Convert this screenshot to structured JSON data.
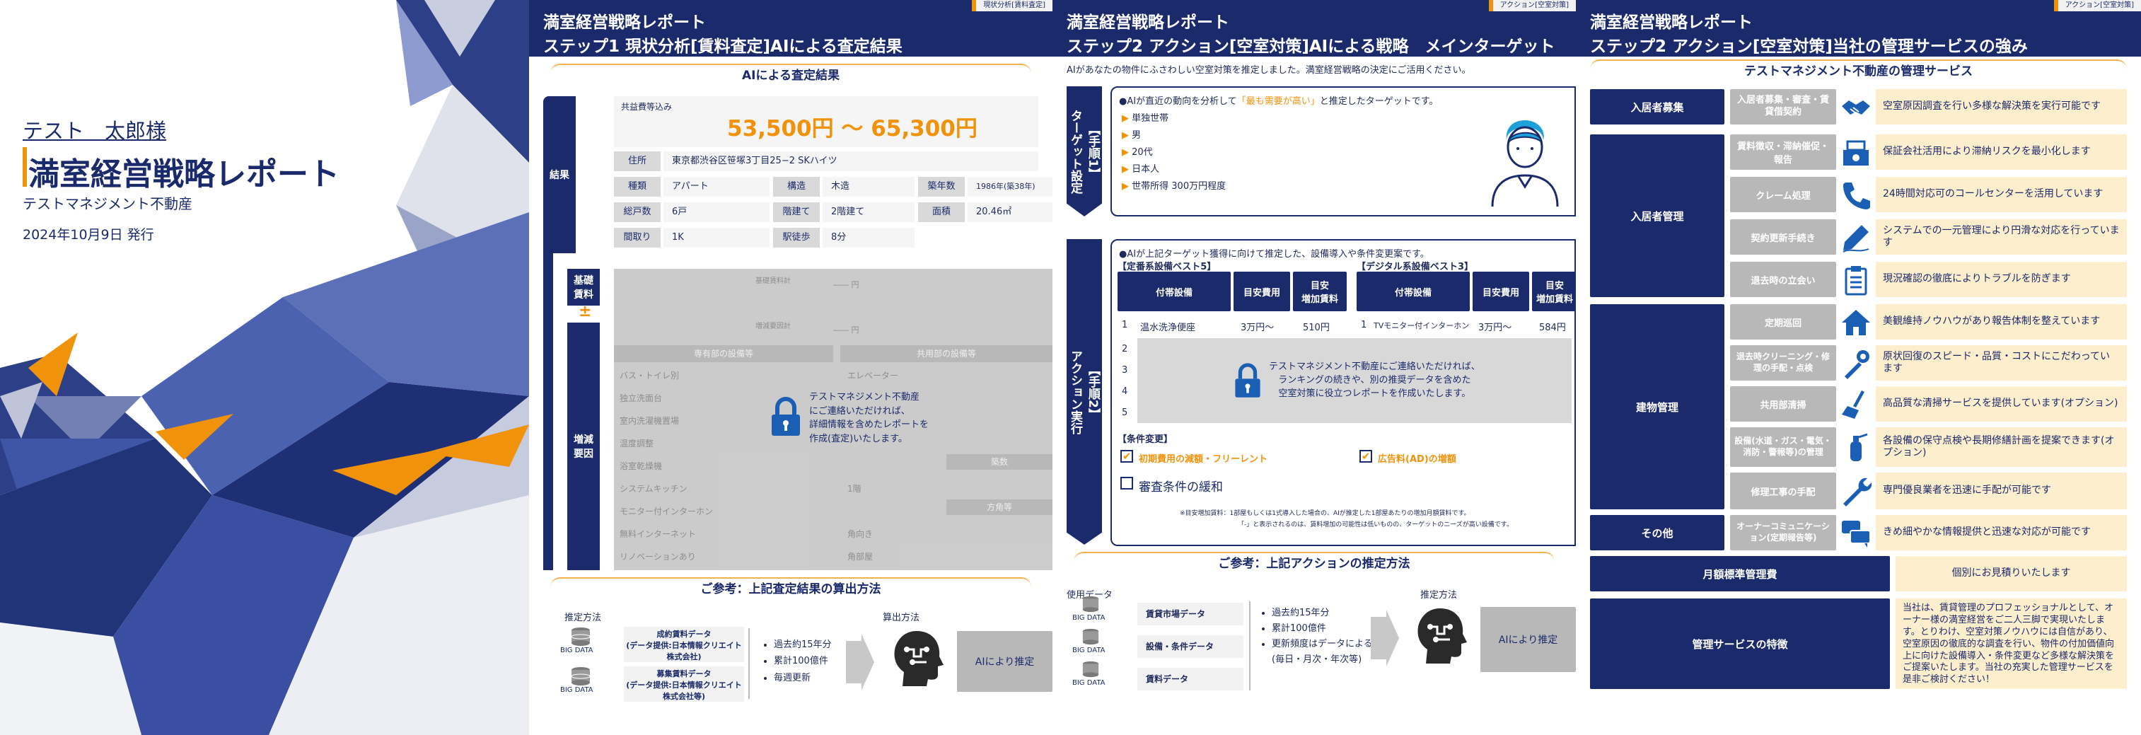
{
  "cover": {
    "customer": "テスト　太郎様",
    "title": "満室経営戦略レポート",
    "company": "テストマネジメント不動産",
    "date": "2024年10月9日 発行"
  },
  "slide1": {
    "header1": "満室経営戦略レポート",
    "header2": "ステップ1 現状分析[賃料査定]AIによる査定結果",
    "tag": "現状分析[賃料査定]",
    "section1": "AIによる査定結果",
    "side_result": "結果",
    "side_base": "基礎\n賃料",
    "side_pm": "±",
    "side_factor": "増減\n要因",
    "rent_label": "共益費等込み",
    "rent_range": "53,500円 〜 65,300円",
    "address_label": "住所",
    "address": "東京都渋谷区笹塚3丁目25−2 SKハイツ",
    "props": [
      {
        "k": "種類",
        "v": "アパート"
      },
      {
        "k": "構造",
        "v": "木造"
      },
      {
        "k": "築年数",
        "v": "1986年(築38年)"
      },
      {
        "k": "総戸数",
        "v": "6戸"
      },
      {
        "k": "階建て",
        "v": "2階建て"
      },
      {
        "k": "面積",
        "v": "20.46㎡"
      },
      {
        "k": "間取り",
        "v": "1K"
      },
      {
        "k": "駅徒歩",
        "v": "8分"
      }
    ],
    "base_total": "基礎賃料計",
    "base_yen": "―― 円",
    "inc_total": "増減要因計",
    "inc_yen": "―― 円",
    "own_header": "専有部の設備等",
    "common_header": "共用部の設備等",
    "own_items": [
      "バス・トイレ別",
      "独立洗面台",
      "室内洗濯機置場",
      "温度調整",
      "浴室乾燥機",
      "システムキッチン",
      "モニター付インターホン",
      "無料インターネット",
      "リノベーションあり"
    ],
    "common_items": [
      "エレベーター",
      "",
      "",
      "",
      "築数",
      "1階",
      "方角等",
      "角向き",
      "角部屋"
    ],
    "dash": "―",
    "lock_text": "テストマネジメント不動産\nにご連絡いただければ、\n詳細情報を含めたレポートを\n作成(査定)いたします。",
    "section2": "ご参考：上記査定結果の算出方法",
    "method_label": "推定方法",
    "calc_label": "算出方法",
    "bigdata": "BIG DATA",
    "data1": "成約賃料データ\n(データ提供:日本情報クリエイト株式会社)",
    "data2": "募集賃料データ\n(データ提供:日本情報クリエイト株式会社等)",
    "bullets": [
      "過去約15年分",
      "累計100億件",
      "毎週更新"
    ],
    "ai_estimate": "AIにより推定"
  },
  "slide2": {
    "header1": "満室経営戦略レポート",
    "header2": "ステップ2 アクション[空室対策]AIによる戦略　メインターゲット",
    "tag": "アクション[空室対策]",
    "intro": "AIがあなたの物件にふさわしい空室対策を推定しました。満室経営戦略の決定にご活用ください。",
    "side_target": "【手順1】\nターゲット設定",
    "side_action": "【手順2】\nアクション実行",
    "target_lead_pre": "AIが直近の動向を分析して",
    "target_lead_hl": "「最も需要が高い」",
    "target_lead_post": "と推定したターゲットです。",
    "targets": [
      "単独世帯",
      "男",
      "20代",
      "日本人",
      "世帯所得 300万円程度"
    ],
    "action_lead": "AIが上記ターゲット獲得に向けて推定した、設備導入や条件変更案です。",
    "rent_best": "【定番系設備ベスト5】",
    "digital_best": "【デジタル系設備ベスト3】",
    "col_equip": "付帯設備",
    "col_cost": "目安費用",
    "col_rise": "目安\n増加賃料",
    "row1": {
      "n": "1",
      "equip": "温水洗浄便座",
      "cost": "3万円〜",
      "rise": "510円"
    },
    "row1d": {
      "n": "1",
      "equip": "TVモニター付インターホン",
      "cost": "3万円〜",
      "rise": "584円"
    },
    "row_nums": [
      "2",
      "3",
      "4",
      "5"
    ],
    "lock_text": "テストマネジメント不動産にご連絡いただければ、\nランキングの続きや、別の推奨データを含めた\n空室対策に役立つレポートを作成いたします。",
    "cond_header": "【条件変更】",
    "cond1": "初期費用の減額・フリーレント",
    "cond2": "広告料(AD)の増額",
    "cond3": "審査条件の緩和",
    "note1": "※目安増加賃料：1部屋もしくは1式導入した場合の、AIが推定した1部屋あたりの増加月額賃料です。",
    "note2": "「-」と表示されるのは、賃料増加の可能性は低いものの、ターゲットのニーズが高い設備です。",
    "section2": "ご参考：上記アクションの推定方法",
    "use_data": "使用データ",
    "method_label": "推定方法",
    "bigdata": "BIG DATA",
    "data": [
      "賃貸市場データ",
      "設備・条件データ",
      "賃料データ"
    ],
    "bullets": [
      "過去約15年分",
      "累計100億件",
      "更新頻度はデータによる(毎日・月次・年次等)"
    ],
    "ai_estimate": "AIにより推定"
  },
  "slide3": {
    "header1": "満室経営戦略レポート",
    "header2": "ステップ2 アクション[空室対策]当社の管理サービスの強み",
    "tag": "アクション[空室対策]",
    "section": "テストマネジメント不動産の管理サービス",
    "groups": [
      {
        "name": "入居者募集",
        "items": [
          {
            "svc": "入居者募集・審査・賃貸借契約",
            "desc": "空室原因調査を行い多様な解決策を実行可能です",
            "icon": "handshake-icon"
          }
        ]
      },
      {
        "name": "入居者管理",
        "items": [
          {
            "svc": "賃料徴収・滞納催促・報告",
            "desc": "保証会社活用により滞納リスクを最小化します",
            "icon": "cash-register-icon"
          },
          {
            "svc": "クレーム処理",
            "desc": "24時間対応可のコールセンターを活用しています",
            "icon": "phone-icon"
          },
          {
            "svc": "契約更新手続き",
            "desc": "システムでの一元管理により円滑な対応を行っています",
            "icon": "pen-icon"
          },
          {
            "svc": "退去時の立会い",
            "desc": "現況確認の徹底によりトラブルを防ぎます",
            "icon": "clipboard-icon"
          }
        ]
      },
      {
        "name": "建物管理",
        "items": [
          {
            "svc": "定期巡回",
            "desc": "美観維持ノウハウがあり報告体制を整えています",
            "icon": "house-icon"
          },
          {
            "svc": "退去時クリーニング・修理の手配・点検",
            "desc": "原状回復のスピード・品質・コストにこだわっています",
            "icon": "tools-icon"
          },
          {
            "svc": "共用部清掃",
            "desc": "高品質な清掃サービスを提供しています(オプション)",
            "icon": "broom-icon"
          },
          {
            "svc": "設備(水道・ガス・電気・消防・警報等)の管理",
            "desc": "各設備の保守点検や長期修繕計画を提案できます(オプション)",
            "icon": "extinguisher-icon"
          },
          {
            "svc": "修理工事の手配",
            "desc": "専門優良業者を迅速に手配が可能です",
            "icon": "wrench-icon"
          }
        ]
      },
      {
        "name": "その他",
        "items": [
          {
            "svc": "オーナーコミュニケーション(定期報告等)",
            "desc": "きめ細やかな情報提供と迅速な対応が可能です",
            "icon": "chat-icon"
          }
        ]
      }
    ],
    "fee_label": "月額標準管理費",
    "fee_value": "個別にお見積りいたします",
    "feature_label": "管理サービスの特徴",
    "feature_text": "当社は、賃貸管理のプロフェッショナルとして、オーナー様の満室経営をご二人三脚で実現いたします。とりわけ、空室対策ノウハウには自信があり、空室原因の徹底的な調査を行い、物件の付加価値向上に向けた設備導入・条件変更など多様な解決策をご提案いたします。当社の充実した管理サービスを是非ご検討ください！"
  }
}
